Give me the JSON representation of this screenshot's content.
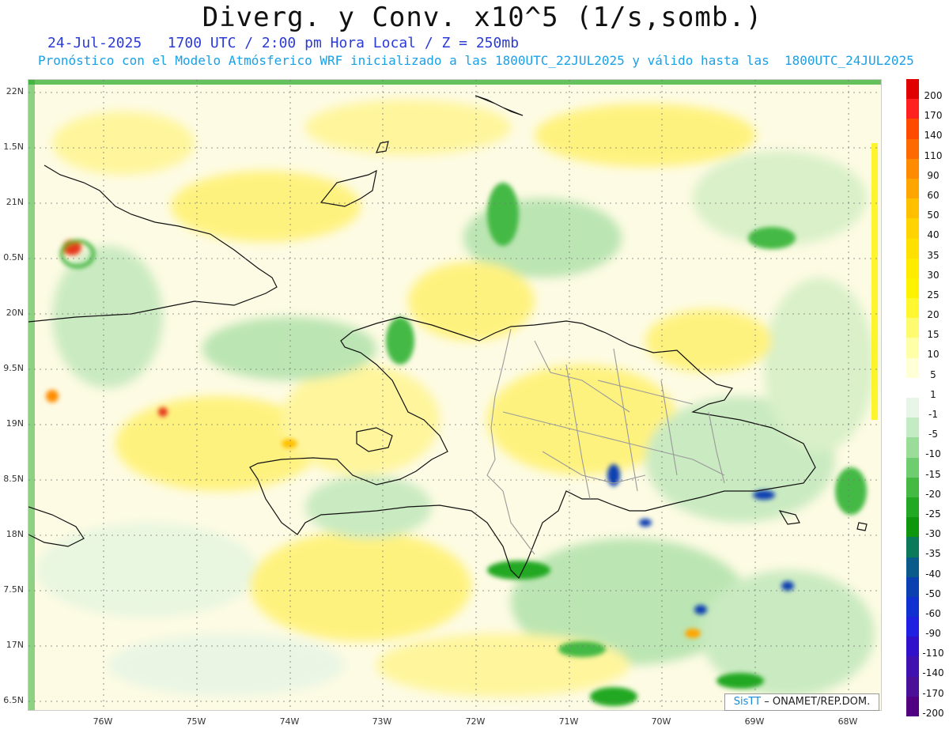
{
  "title": "Diverg. y Conv. x10^5 (1/s,somb.)",
  "subtitle_date": "24-Jul-2025   1700 UTC / 2:00 pm Hora Local / Z = 250mb",
  "subtitle_model": "Pronóstico con el Modelo Atmósferico WRF inicializado a las 1800UTC_22JUL2025 y válido hasta las  1800UTC_24JUL2025",
  "lat_labels": [
    "22N",
    "1.5N",
    "21N",
    "0.5N",
    "20N",
    "9.5N",
    "19N",
    "8.5N",
    "18N",
    "7.5N",
    "17N",
    "6.5N"
  ],
  "lon_labels": [
    "76W",
    "75W",
    "74W",
    "73W",
    "72W",
    "71W",
    "70W",
    "69W",
    "68W"
  ],
  "colorbar": {
    "labels": [
      "200",
      "170",
      "140",
      "110",
      "90",
      "60",
      "50",
      "40",
      "35",
      "30",
      "25",
      "20",
      "15",
      "10",
      "5",
      "1",
      "-1",
      "-5",
      "-10",
      "-15",
      "-20",
      "-25",
      "-30",
      "-35",
      "-40",
      "-50",
      "-60",
      "-90",
      "-110",
      "-140",
      "-170",
      "-200"
    ],
    "colors": [
      "#e00000",
      "#ff2020",
      "#ff4a00",
      "#ff6a00",
      "#ff8c00",
      "#ffa500",
      "#ffc000",
      "#ffd400",
      "#ffe000",
      "#ffec00",
      "#fff200",
      "#fff830",
      "#fffb70",
      "#ffffa8",
      "#ffffd8",
      "#ffffff",
      "#e8f6e8",
      "#c4ecc4",
      "#99dd99",
      "#6fcc6f",
      "#44b944",
      "#22a822",
      "#0f960f",
      "#0a7a5a",
      "#0a5a8a",
      "#0a40b0",
      "#1030d0",
      "#2020e0",
      "#3010c8",
      "#4010b0",
      "#4a1098",
      "#500080"
    ]
  },
  "credit": {
    "brand": "SisTT",
    "text": "– ONAMET/REP.DOM."
  }
}
